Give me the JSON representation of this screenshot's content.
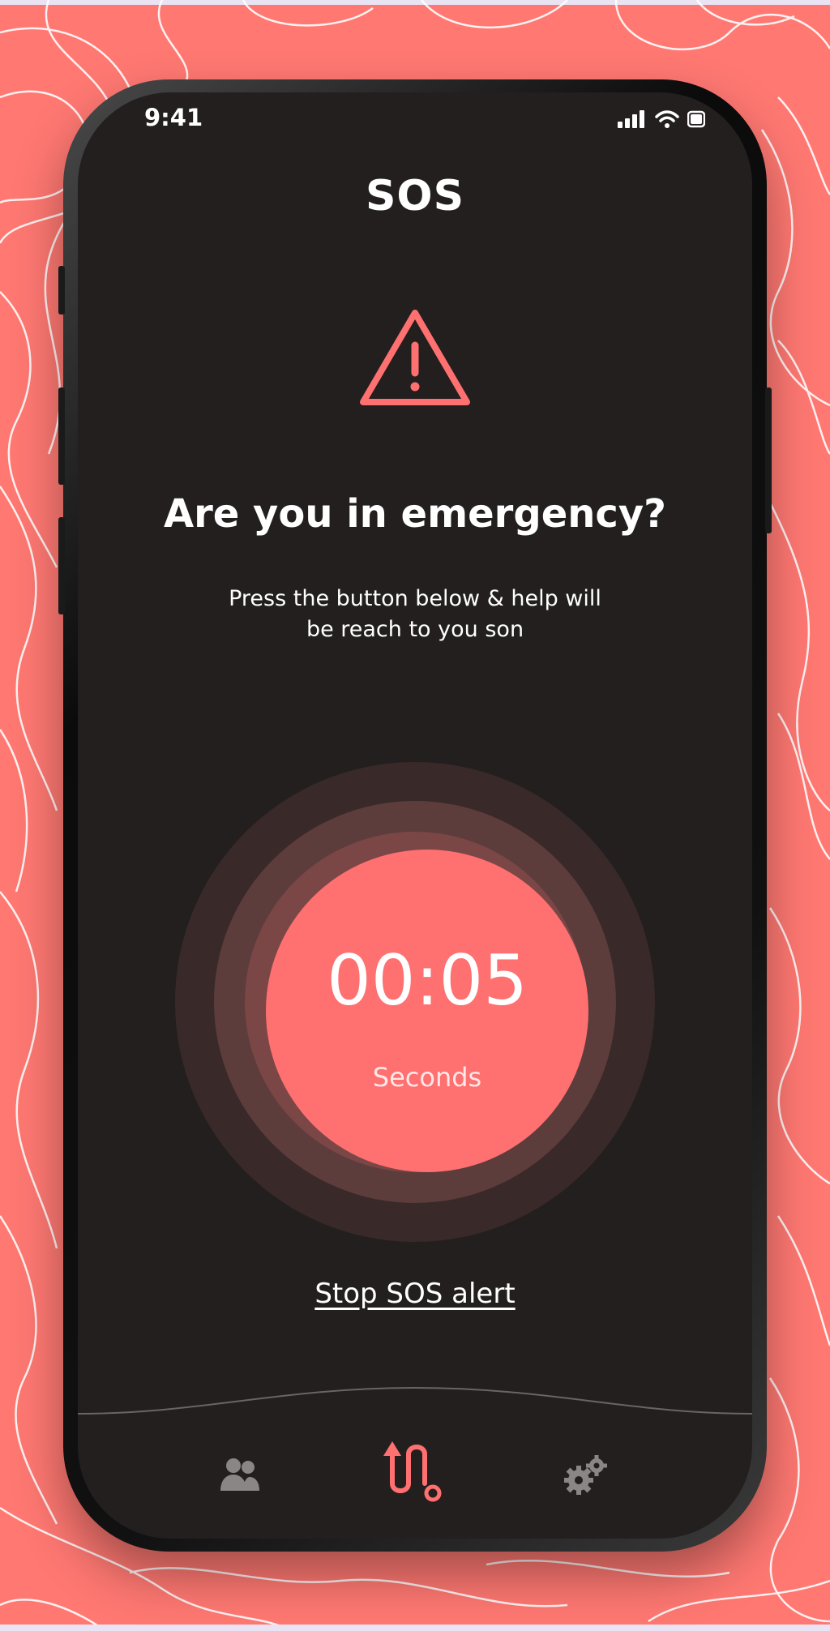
{
  "status_bar": {
    "time": "9:41",
    "icons": [
      "signal-icon",
      "wifi-icon",
      "battery-icon"
    ]
  },
  "header": {
    "title": "SOS"
  },
  "alert": {
    "icon": "warning-triangle-icon",
    "heading": "Are you in emergency?",
    "subtext": "Press the button below & help will be reach to you son"
  },
  "sos_button": {
    "timer": "00:05",
    "unit": "Seconds"
  },
  "stop_link": "Stop SOS alert",
  "bottom_nav": {
    "items": [
      {
        "icon": "contacts-icon",
        "active": false
      },
      {
        "icon": "route-icon",
        "active": true
      },
      {
        "icon": "settings-gears-icon",
        "active": false
      }
    ]
  },
  "colors": {
    "accent": "#ff7070",
    "background": "#ff7872",
    "screen": "#231f1f",
    "inactive_icon": "#8a8686"
  }
}
